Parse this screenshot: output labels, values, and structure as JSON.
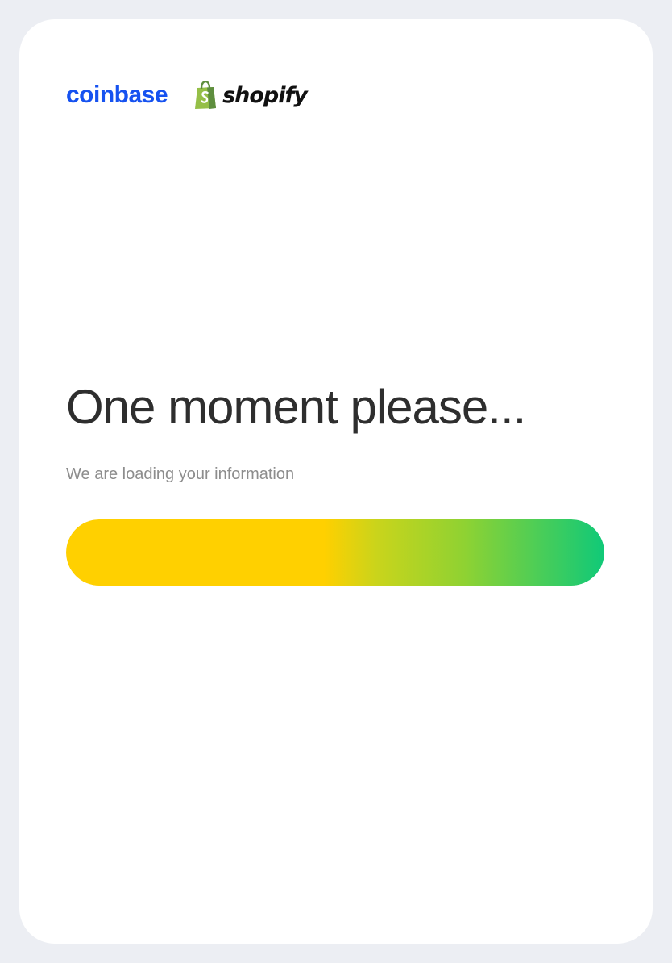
{
  "brand": {
    "coinbase_logo": "coinbase",
    "shopify_logo": "shopify",
    "shopify_icon": "shopping-bag-icon",
    "colors": {
      "coinbase": "#1652f0",
      "shopify_bag": "#95bf47",
      "shopify_text": "#111111"
    }
  },
  "loading": {
    "title": "One moment please...",
    "subtitle": "We are loading your information"
  },
  "progress": {
    "fraction": 1.0,
    "colors": {
      "start": "#ffd000",
      "end": "#10c978"
    }
  }
}
